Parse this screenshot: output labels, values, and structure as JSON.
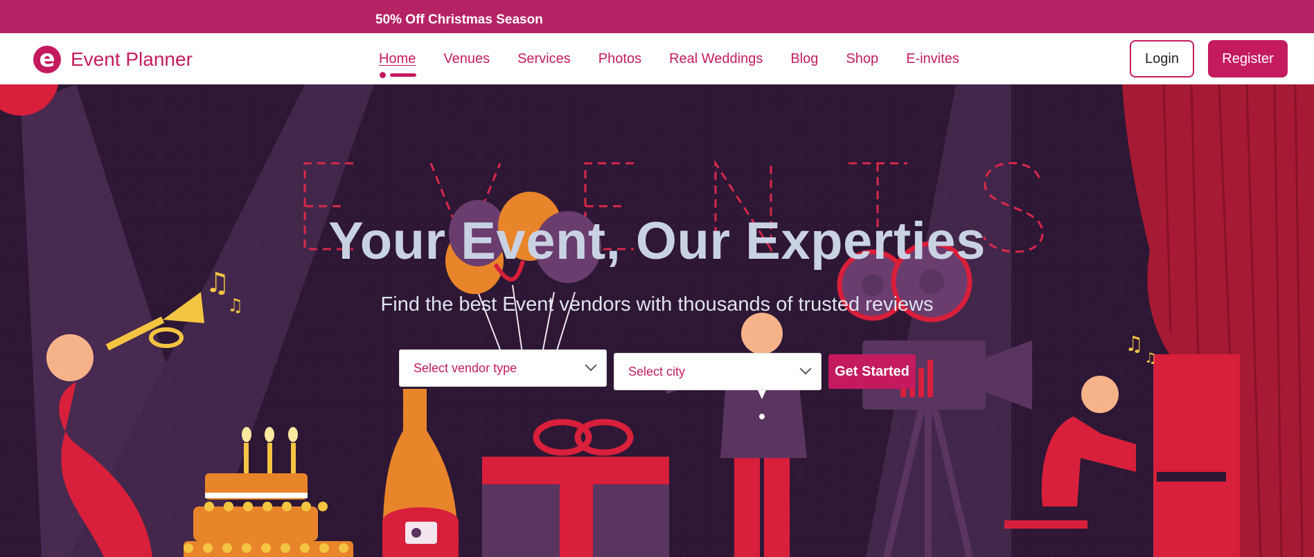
{
  "promo": {
    "text": "50% Off Christmas Season"
  },
  "brand": {
    "logo_letter": "e",
    "name": "Event Planner",
    "color": "#c41b5f"
  },
  "nav": {
    "items": [
      {
        "label": "Home",
        "active": true
      },
      {
        "label": "Venues"
      },
      {
        "label": "Services"
      },
      {
        "label": "Photos"
      },
      {
        "label": "Real Weddings"
      },
      {
        "label": "Blog"
      },
      {
        "label": "Shop"
      },
      {
        "label": "E-invites"
      }
    ],
    "login_label": "Login",
    "register_label": "Register"
  },
  "hero": {
    "background_word": "EVENTS",
    "title": "Your Event, Our Experties",
    "subtitle": "Find the best Event vendors with thousands of trusted reviews",
    "vendor_select": {
      "selected": "Select vendor type"
    },
    "city_select": {
      "selected": "Select city"
    },
    "cta_label": "Get Started"
  },
  "colors": {
    "promo_bg": "#b52364",
    "accent": "#c41b5f",
    "hero_bg": "#2d1734"
  }
}
